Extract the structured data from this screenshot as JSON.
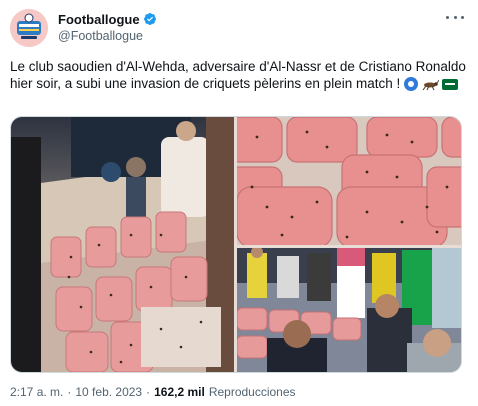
{
  "author": {
    "display_name": "Footballogue",
    "handle": "@Footballogue",
    "verified": true,
    "avatar_color": "#f7c9c6"
  },
  "tweet": {
    "text": "Le club saoudien d'Al-Wehda, adversaire d'Al-Nassr et de Cristiano Ronaldo hier soir, a subi une invasion de criquets pèlerins en plein match !",
    "emojis": [
      "soccer-ball-emoji",
      "cricket-emoji",
      "saudi-arabia-flag-emoji"
    ]
  },
  "media": {
    "images": [
      {
        "name": "stadium-seats-crickets-wide"
      },
      {
        "name": "seats-crickets-closeup"
      },
      {
        "name": "fans-in-stands"
      }
    ]
  },
  "meta": {
    "time": "2:17 a. m.",
    "separator": "·",
    "date": "10 feb. 2023",
    "views_count": "162,2 mil",
    "views_label": "Reproducciones"
  },
  "colors": {
    "text_primary": "#0f1419",
    "text_secondary": "#536471",
    "verified_blue": "#1d9bf0",
    "border": "#cfd9de"
  }
}
